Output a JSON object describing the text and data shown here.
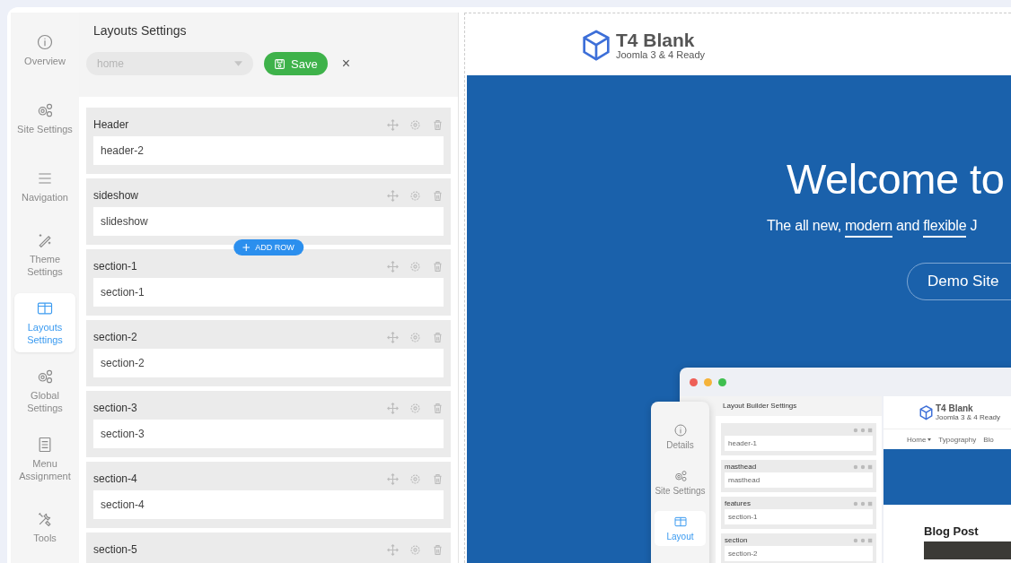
{
  "sidebar": {
    "items": [
      {
        "label": "Overview",
        "kind": "info",
        "selected": false
      },
      {
        "label": "Site Settings",
        "kind": "gears",
        "selected": false
      },
      {
        "label": "Navigation",
        "kind": "menu",
        "selected": false
      },
      {
        "label": "Theme Settings",
        "kind": "wand",
        "selected": false
      },
      {
        "label": "Layouts Settings",
        "kind": "columns",
        "selected": true
      },
      {
        "label": "Global Settings",
        "kind": "gears",
        "selected": false
      },
      {
        "label": "Menu Assignment",
        "kind": "list",
        "selected": false
      },
      {
        "label": "Tools",
        "kind": "tools",
        "selected": false
      }
    ]
  },
  "panel": {
    "title": "Layouts Settings",
    "layout_select": {
      "placeholder": "home"
    },
    "save_button": "Save",
    "close_button": "×",
    "rows": [
      {
        "title": "Header",
        "value": "header-2"
      },
      {
        "title": "sideshow",
        "value": "slideshow",
        "add_row_button": "ADD ROW"
      },
      {
        "title": "section-1",
        "value": "section-1"
      },
      {
        "title": "section-2",
        "value": "section-2"
      },
      {
        "title": "section-3",
        "value": "section-3"
      },
      {
        "title": "section-4",
        "value": "section-4"
      },
      {
        "title": "section-5"
      }
    ]
  },
  "preview": {
    "logo": {
      "name": "T4 Blank",
      "tagline": "Joomla 3 & 4 Ready"
    },
    "hero": {
      "headline": "Welcome to",
      "subtitle": [
        {
          "text": "The all new,",
          "underlined": false
        },
        {
          "text": "modern",
          "underlined": true
        },
        {
          "text": "and",
          "underlined": false
        },
        {
          "text": "flexible",
          "underlined": true
        },
        {
          "text": "J",
          "underlined": false
        }
      ],
      "button": "Demo Site"
    },
    "mockup": {
      "sidebar": [
        {
          "label": "Details",
          "kind": "info",
          "selected": false
        },
        {
          "label": "Site Settings",
          "kind": "gears",
          "selected": false
        },
        {
          "label": "Layout",
          "kind": "columns",
          "selected": true
        }
      ],
      "panel_title": "Layout Builder Settings",
      "rows": [
        {
          "value": "header-1"
        },
        {
          "title": "masthead",
          "value": "masthead"
        },
        {
          "title": "features",
          "value": "section-1"
        },
        {
          "title": "section",
          "value": "section-2"
        }
      ],
      "logo": {
        "name": "T4 Blank",
        "tagline": "Joomla 3 & 4 Ready"
      },
      "nav": [
        {
          "label": "Home",
          "dropdown": true
        },
        {
          "label": "Typography",
          "dropdown": false
        },
        {
          "label": "Blo",
          "dropdown": false
        }
      ],
      "blog_title": "Blog Post"
    }
  }
}
